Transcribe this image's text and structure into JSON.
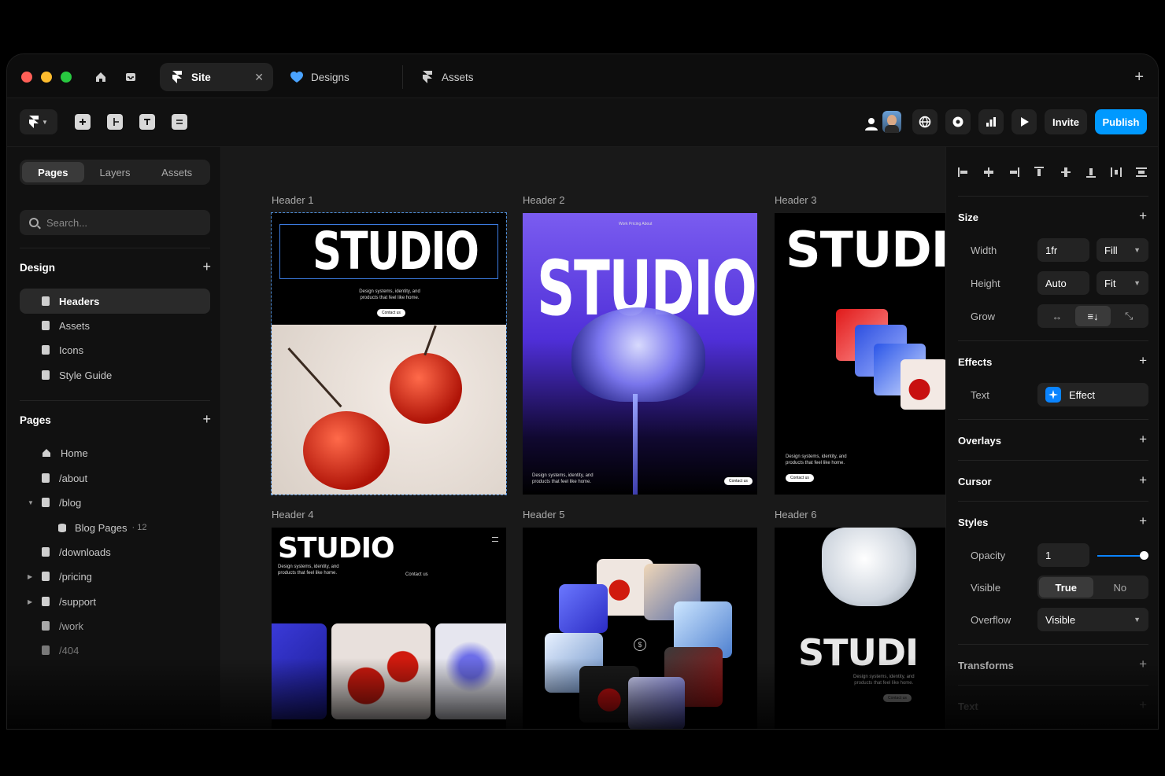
{
  "tabs": [
    {
      "label": "Site",
      "active": true
    },
    {
      "label": "Designs",
      "active": false
    },
    {
      "label": "Assets",
      "active": false
    }
  ],
  "toolbar": {
    "invite_label": "Invite",
    "publish_label": "Publish"
  },
  "sidebar": {
    "segments": [
      "Pages",
      "Layers",
      "Assets"
    ],
    "search_placeholder": "Search...",
    "design_title": "Design",
    "design_items": [
      "Headers",
      "Assets",
      "Icons",
      "Style Guide"
    ],
    "pages_title": "Pages",
    "pages_items": [
      {
        "label": "Home"
      },
      {
        "label": "/about"
      },
      {
        "label": "/blog"
      },
      {
        "label": "Blog Pages",
        "count": "12"
      },
      {
        "label": "/downloads"
      },
      {
        "label": "/pricing"
      },
      {
        "label": "/support"
      },
      {
        "label": "/work"
      },
      {
        "label": "/404"
      }
    ]
  },
  "canvas": {
    "frames": [
      "Header 1",
      "Header 2",
      "Header 3",
      "Header 4",
      "Header 5",
      "Header 6"
    ],
    "word": "STUDIO",
    "word_cut": "STUDI",
    "tagline_a": "Design systems, identity, and",
    "tagline_b": "products that feel like home.",
    "contact": "Contact us",
    "h2_nav": "Work   Pricing   About",
    "h6_tag_a": "Design systems, identity, and",
    "h6_tag_b": "products that feel like home."
  },
  "panel": {
    "size_title": "Size",
    "width_label": "Width",
    "width_value": "1fr",
    "width_mode": "Fill",
    "height_label": "Height",
    "height_value": "Auto",
    "height_mode": "Fit",
    "grow_label": "Grow",
    "effects_title": "Effects",
    "text_label": "Text",
    "effect_value": "Effect",
    "overlays_title": "Overlays",
    "cursor_title": "Cursor",
    "styles_title": "Styles",
    "opacity_label": "Opacity",
    "opacity_value": "1",
    "visible_label": "Visible",
    "visible_true": "True",
    "visible_no": "No",
    "overflow_label": "Overflow",
    "overflow_value": "Visible",
    "transforms_title": "Transforms",
    "text_title": "Text"
  },
  "colors": {
    "accent": "#0099ff",
    "bg": "#111111"
  }
}
